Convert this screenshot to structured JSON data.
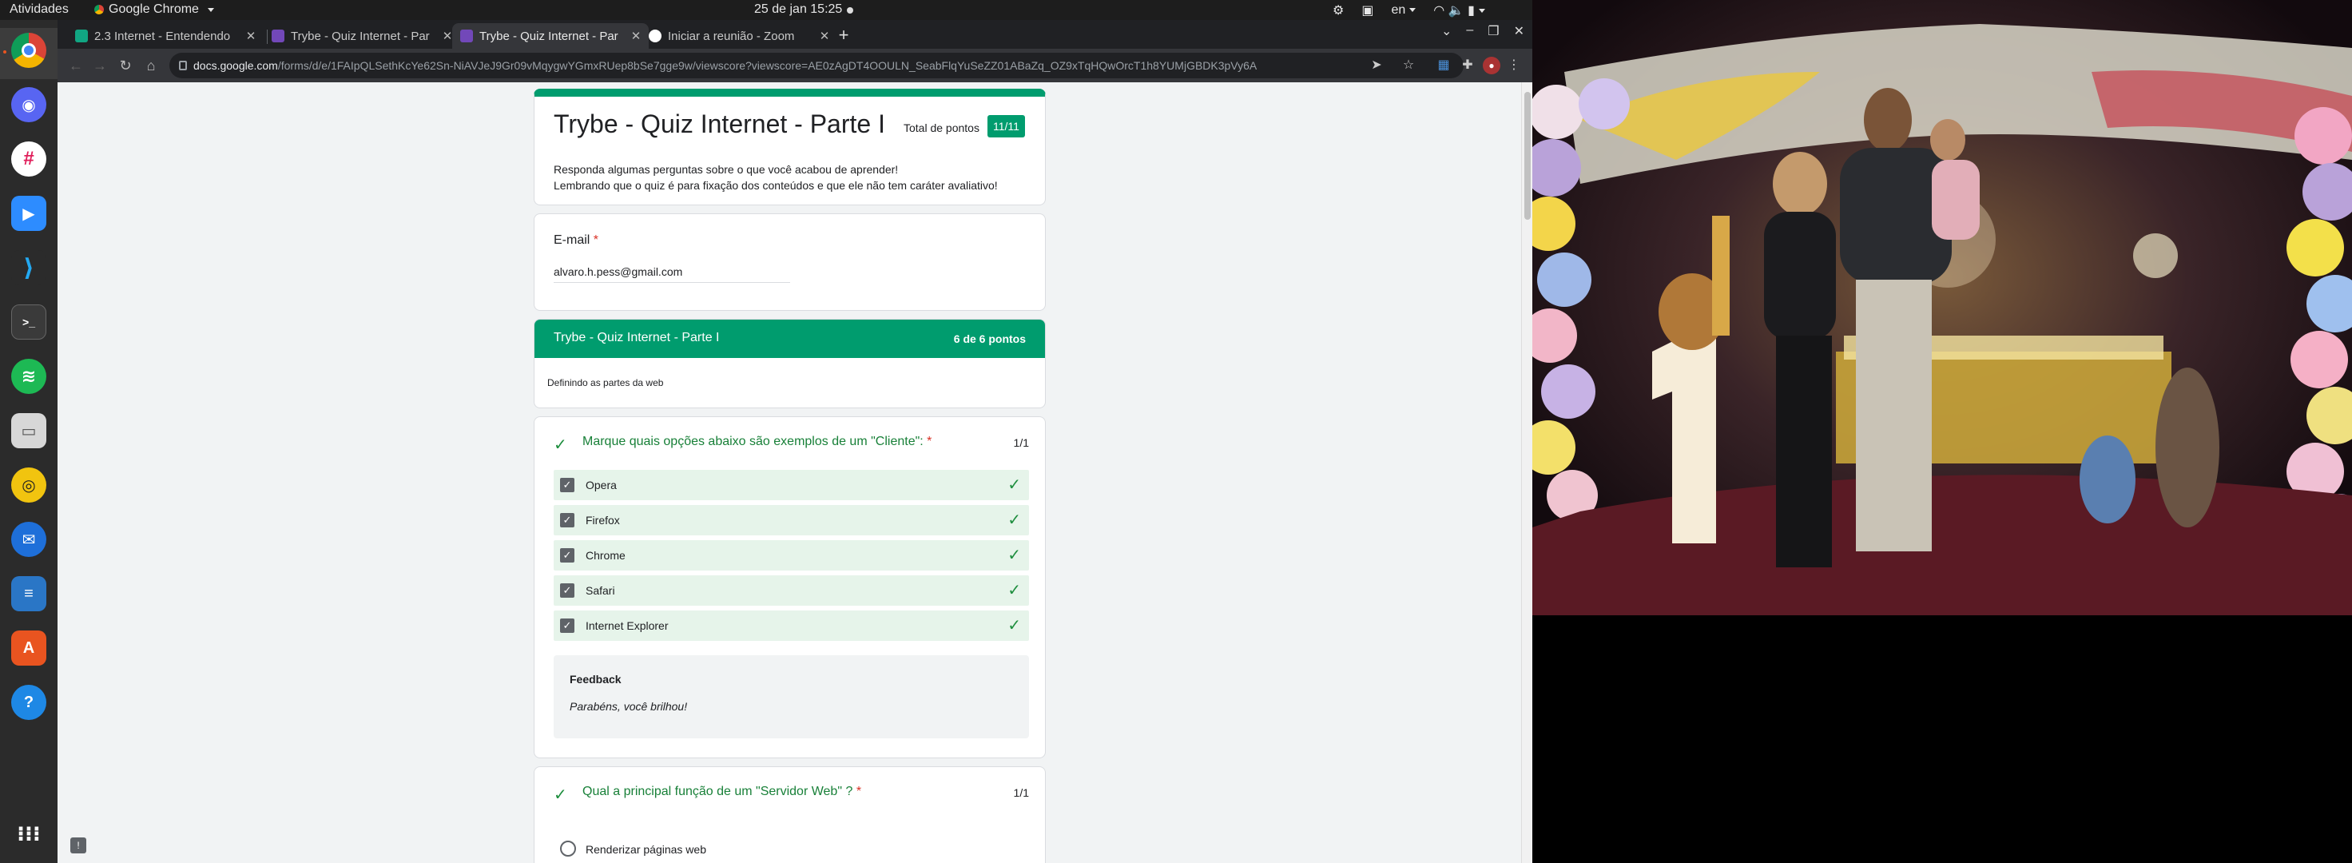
{
  "topbar": {
    "activities": "Atividades",
    "app_name": "Google Chrome",
    "clock": "25 de jan  15:25",
    "lang": "en"
  },
  "dock": {
    "items": [
      "chrome",
      "discord",
      "slack",
      "zoom",
      "vscode",
      "terminal",
      "spotify",
      "files",
      "rhythmbox",
      "thunderbird",
      "libreoffice-writer",
      "ubuntu-software",
      "help",
      "app-grid"
    ]
  },
  "tabs": [
    {
      "title": "2.3 Internet - Entendendo",
      "color": "#11a683"
    },
    {
      "title": "Trybe - Quiz Internet - Par",
      "color": "#7248b9"
    },
    {
      "title": "Trybe - Quiz Internet - Par",
      "color": "#7248b9"
    },
    {
      "title": "Iniciar a reunião - Zoom",
      "color": "#ffffff"
    }
  ],
  "omnibox": {
    "host": "docs.google.com",
    "path": "/forms/d/e/1FAIpQLSethKcYe62Sn-NiAVJeJ9Gr09vMqygwYGmxRUep8bSe7gge9w/viewscore?viewscore=AE0zAgDT4OOULN_SeabFlqYuSeZZ01ABaZq_OZ9xTqHQwOrcT1h8YUMjGBDK3pVy6A"
  },
  "form": {
    "title": "Trybe - Quiz Internet - Parte I",
    "score_label": "Total de pontos",
    "score": "11/11",
    "description_line1": "Responda algumas perguntas sobre o que você acabou de aprender!",
    "description_line2": "Lembrando que o quiz é para fixação dos conteúdos e que ele não tem caráter avaliativo!",
    "email_label": "E-mail",
    "required_mark": "*",
    "email_value": "alvaro.h.pess@gmail.com",
    "section_title": "Trybe - Quiz Internet - Parte I",
    "section_points": "6 de 6 pontos",
    "section_subtitle": "Definindo as partes da web",
    "q1": {
      "text": "Marque quais opções abaixo são exemplos de um \"Cliente\":",
      "points": "1/1",
      "options": [
        "Opera",
        "Firefox",
        "Chrome",
        "Safari",
        "Internet Explorer"
      ],
      "feedback_title": "Feedback",
      "feedback_text": "Parabéns, você brilhou!"
    },
    "q2": {
      "text": "Qual a principal função de um \"Servidor Web\" ?",
      "points": "1/1",
      "first_option": "Renderizar páginas web"
    }
  },
  "colors": {
    "accent": "#009c6e",
    "correct_bg": "#e6f4ea",
    "correct_text": "#188038",
    "required": "#d93025"
  }
}
